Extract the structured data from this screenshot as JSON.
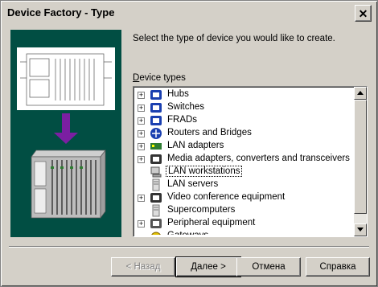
{
  "window": {
    "title": "Device Factory - Type",
    "close_glyph": "✕"
  },
  "description": "Select the type of device you would like to create.",
  "device_types": {
    "label_prefix": "D",
    "label_rest": "evice types",
    "items": [
      {
        "label": "Hubs",
        "icon": "hub-icon",
        "color": "#1a3fb0",
        "expandable": true
      },
      {
        "label": "Switches",
        "icon": "switch-icon",
        "color": "#1a3fb0",
        "expandable": true
      },
      {
        "label": "FRADs",
        "icon": "frad-icon",
        "color": "#1a3fb0",
        "expandable": true
      },
      {
        "label": "Routers and Bridges",
        "icon": "router-icon",
        "color": "#1a3fb0",
        "expandable": true
      },
      {
        "label": "LAN adapters",
        "icon": "lan-adapter-icon",
        "color": "#2e7d32",
        "expandable": true
      },
      {
        "label": "Media adapters, converters and transceivers",
        "icon": "media-adapter-icon",
        "color": "#333333",
        "expandable": true
      },
      {
        "label": "LAN workstations",
        "icon": "workstation-icon",
        "color": "#555555",
        "expandable": false,
        "selected": true
      },
      {
        "label": "LAN servers",
        "icon": "server-icon",
        "color": "#777777",
        "expandable": false
      },
      {
        "label": "Video conference equipment",
        "icon": "video-conference-icon",
        "color": "#333333",
        "expandable": true
      },
      {
        "label": "Supercomputers",
        "icon": "supercomputer-icon",
        "color": "#777777",
        "expandable": false
      },
      {
        "label": "Peripheral equipment",
        "icon": "peripheral-icon",
        "color": "#555555",
        "expandable": true
      },
      {
        "label": "Gateways",
        "icon": "gateway-icon",
        "color": "#e0c000",
        "expandable": false
      }
    ]
  },
  "buttons": {
    "back": "< Назад",
    "next": "Далее >",
    "cancel": "Отмена",
    "help": "Справка"
  },
  "colors": {
    "illustration_bg": "#014e43",
    "arrow": "#7b1fa2"
  }
}
